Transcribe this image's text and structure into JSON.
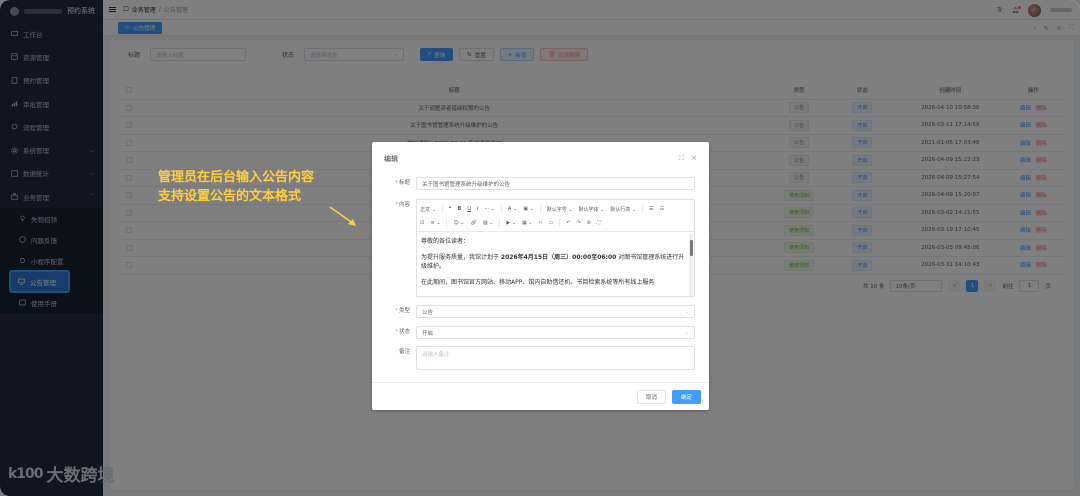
{
  "app": {
    "system_name": "预约系统"
  },
  "sidebar": {
    "items": [
      {
        "label": "工作台",
        "icon": "dashboard-icon"
      },
      {
        "label": "资源管理",
        "icon": "resource-icon"
      },
      {
        "label": "预约管理",
        "icon": "booking-icon"
      },
      {
        "label": "审批管理",
        "icon": "approval-icon"
      },
      {
        "label": "流程管理",
        "icon": "process-icon"
      },
      {
        "label": "系统管理",
        "icon": "gear-icon"
      },
      {
        "label": "数据统计",
        "icon": "chart-icon"
      },
      {
        "label": "业务管理",
        "icon": "business-icon"
      }
    ],
    "submenu": [
      {
        "label": "失物招领",
        "icon": "pin-icon"
      },
      {
        "label": "问题反馈",
        "icon": "feedback-icon"
      },
      {
        "label": "小程序配置",
        "icon": "settings-icon"
      },
      {
        "label": "公告管理",
        "icon": "monitor-icon"
      },
      {
        "label": "使用手册",
        "icon": "book-icon"
      }
    ],
    "watermark": "大数跨境",
    "watermark_logo": "k100"
  },
  "header": {
    "breadcrumb_1": "业务管理",
    "breadcrumb_sep": "/",
    "breadcrumb_2": "公告管理",
    "lang": "Tr"
  },
  "tags": {
    "active": "公告管理"
  },
  "filters": {
    "title_label": "标题",
    "title_placeholder": "请输入标题",
    "status_label": "状态",
    "status_placeholder": "请选择状态",
    "search": "查询",
    "reset": "重置",
    "add": "新增",
    "batch_delete": "批量删除"
  },
  "table": {
    "headers": {
      "title": "标题",
      "type": "类型",
      "status": "状态",
      "time": "创建时间",
      "op": "操作"
    },
    "edit": "编辑",
    "delete": "删除",
    "rows": [
      {
        "title": "关于调整读者借阅权限的公告",
        "type": "公告",
        "status": "开启",
        "time": "2026-04-10 10:58:30"
      },
      {
        "title": "关于图书馆管理系统升级维护的公告",
        "type": "公告",
        "status": "开启",
        "time": "2026-03-11 17:14:59"
      },
      {
        "title": "维护通知：2018-07-01 系统凌晨维护",
        "type": "公告",
        "status": "开启",
        "time": "2021-01-05 17:03:48"
      },
      {
        "title": "",
        "type": "公告",
        "status": "开启",
        "time": "2026-04-09 15:22:23"
      },
      {
        "title": "",
        "type": "公告",
        "status": "开启",
        "time": "2026-04-09 15:27:54"
      },
      {
        "title": "",
        "type": "使用须知",
        "status": "开启",
        "time": "2026-04-09 15:20:07"
      },
      {
        "title": "",
        "type": "使用须知",
        "status": "开启",
        "time": "2026-03-02 14:21:55"
      },
      {
        "title": "",
        "type": "使用须知",
        "status": "开启",
        "time": "2026-03-19 17:10:45"
      },
      {
        "title": "",
        "type": "使用须知",
        "status": "开启",
        "time": "2026-03-03 09:45:06"
      },
      {
        "title": "",
        "type": "使用须知",
        "status": "开启",
        "time": "2026-03-31 14:10:43"
      }
    ]
  },
  "pager": {
    "total": "共 10 条",
    "page_size": "10条/页",
    "current": "1",
    "goto": "前往",
    "goto_value": "1",
    "page_unit": "页"
  },
  "callout": {
    "line1": "管理员在后台输入公告内容",
    "line2": "支持设置公告的文本格式"
  },
  "dialog": {
    "title": "编辑",
    "title_label": "标题",
    "title_value": "关于图书馆管理系统升级维护的公告",
    "content_label": "内容",
    "toolbar": {
      "para": "正文",
      "fontsize": "默认字号",
      "fontfamily": "默认字体",
      "lineheight": "默认行高"
    },
    "content": {
      "p1": "尊敬的各位读者：",
      "p2_a": "为提升服务质量，我馆计划于 ",
      "p2_b": "2026年4月15日（周三）00:00至06:00",
      "p2_c": " 对图书馆管理系统进行升级维护。",
      "p3": "在此期间，图书馆官方网站、移动APP、馆内自助借还机、书目检索系统等所有线上服务"
    },
    "type_label": "类型",
    "type_value": "公告",
    "status_label": "状态",
    "status_value": "开启",
    "remark_label": "备注",
    "remark_placeholder": "请输入备注",
    "cancel": "取消",
    "confirm": "确定"
  },
  "colors": {
    "primary": "#409eff",
    "sidebar_bg": "#1f2d3d",
    "callout": "#ffcf3b",
    "danger": "#f56c6c"
  }
}
